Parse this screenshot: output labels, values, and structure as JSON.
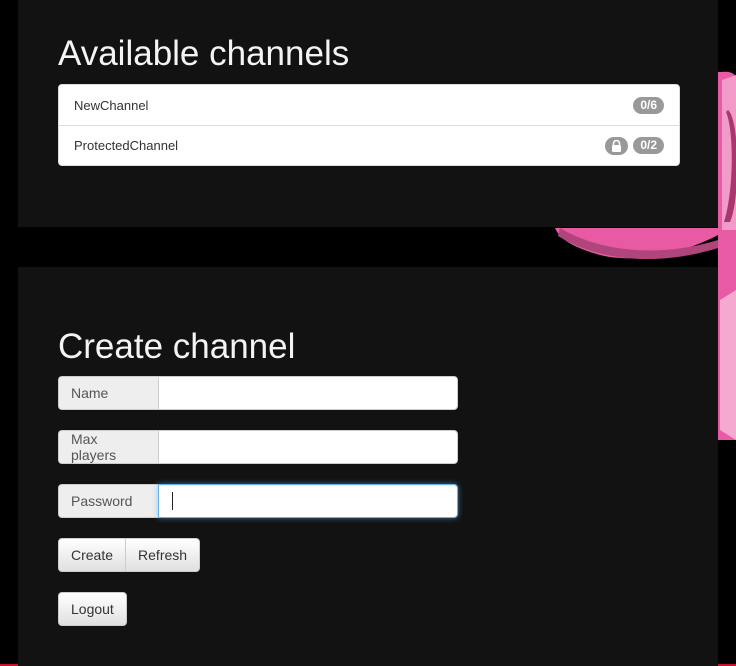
{
  "available": {
    "title": "Available channels",
    "channels": [
      {
        "name": "NewChannel",
        "count": "0/6",
        "locked": false
      },
      {
        "name": "ProtectedChannel",
        "count": "0/2",
        "locked": true
      }
    ]
  },
  "create": {
    "title": "Create channel",
    "fields": {
      "name": {
        "label": "Name",
        "value": ""
      },
      "max_players": {
        "label": "Max players",
        "value": ""
      },
      "password": {
        "label": "Password",
        "value": ""
      }
    },
    "create_label": "Create",
    "refresh_label": "Refresh",
    "logout_label": "Logout"
  },
  "icons": {
    "lock": "lock-icon"
  },
  "colors": {
    "panel": "#121212",
    "badge": "#999999",
    "focus": "#66afe9",
    "ribbon": "#e85aa4",
    "accent_line": "#c8112a"
  }
}
